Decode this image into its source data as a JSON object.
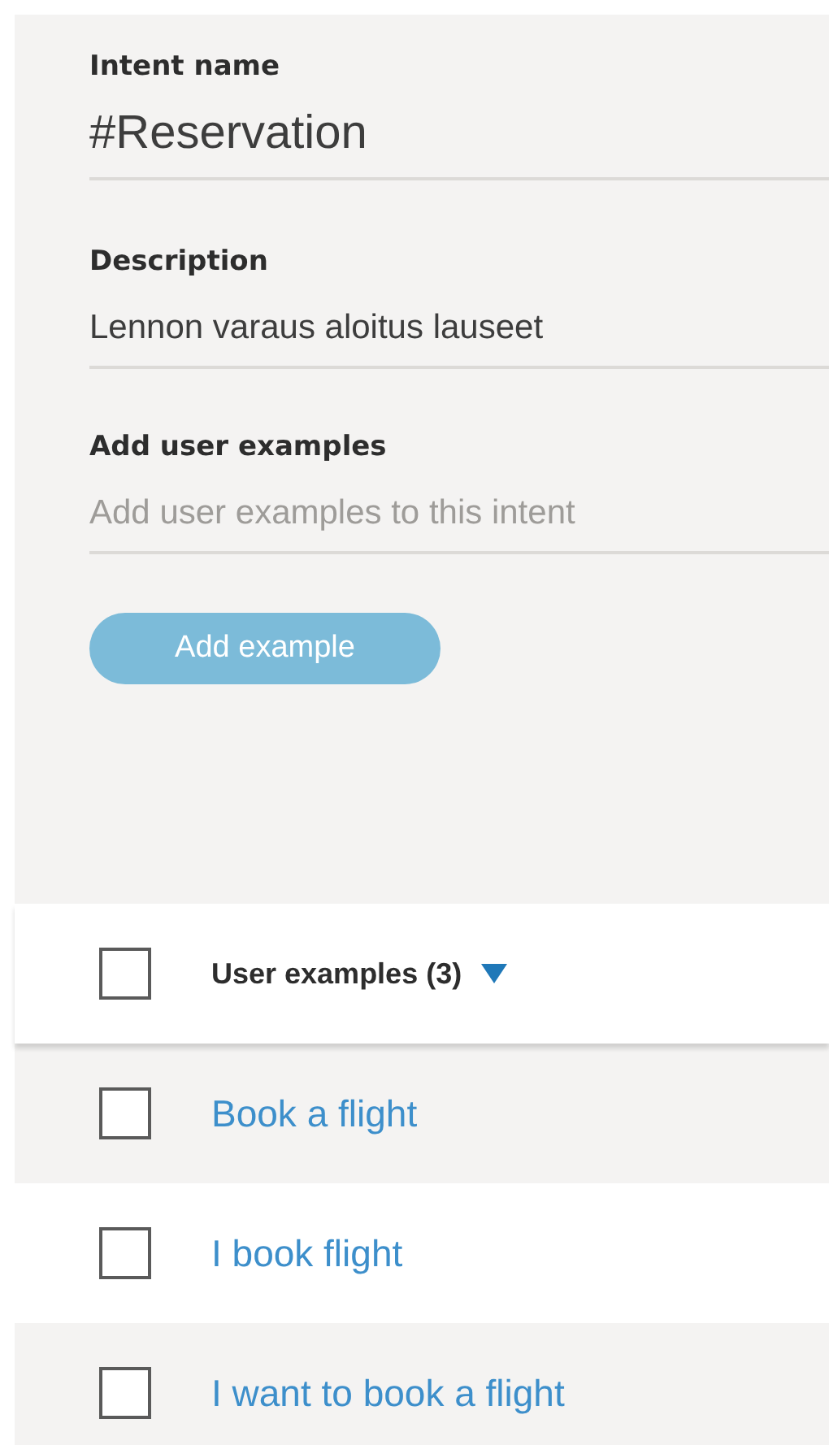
{
  "form": {
    "intent_name": {
      "label": "Intent name",
      "value": "#Reservation"
    },
    "description": {
      "label": "Description",
      "value": "Lennon varaus aloitus lauseet"
    },
    "user_example": {
      "label": "Add user examples",
      "placeholder": "Add user examples to this intent"
    },
    "add_button": {
      "label": "Add example",
      "disabled": true
    }
  },
  "examples": {
    "header": {
      "label": "User examples (3)",
      "checked": false,
      "sort_descending": true
    },
    "rows": [
      {
        "text": "Book a flight",
        "checked": false
      },
      {
        "text": "I book flight",
        "checked": false
      },
      {
        "text": "I want to book a flight",
        "checked": false
      }
    ]
  }
}
